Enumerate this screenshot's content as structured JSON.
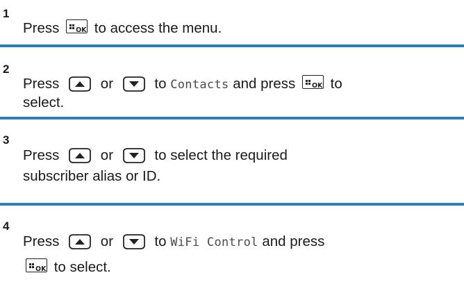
{
  "steps": [
    {
      "number": "1",
      "lines": [
        [
          {
            "t": "text",
            "v": "Press "
          },
          {
            "t": "key",
            "k": "ok"
          },
          {
            "t": "text",
            "v": " to access the menu."
          }
        ]
      ]
    },
    {
      "number": "2",
      "lines": [
        [
          {
            "t": "text",
            "v": "Press "
          },
          {
            "t": "key",
            "k": "up"
          },
          {
            "t": "text",
            "v": " or "
          },
          {
            "t": "key",
            "k": "down"
          },
          {
            "t": "text",
            "v": " to "
          },
          {
            "t": "mono",
            "v": "Contacts"
          },
          {
            "t": "text",
            "v": " and press "
          },
          {
            "t": "key",
            "k": "ok"
          },
          {
            "t": "text",
            "v": " to"
          }
        ],
        [
          {
            "t": "text",
            "v": "select."
          }
        ]
      ]
    },
    {
      "number": "3",
      "lines": [
        [
          {
            "t": "text",
            "v": "Press "
          },
          {
            "t": "key",
            "k": "up"
          },
          {
            "t": "text",
            "v": " or "
          },
          {
            "t": "key",
            "k": "down"
          },
          {
            "t": "text",
            "v": " to select the required"
          }
        ],
        [
          {
            "t": "text",
            "v": "subscriber alias or ID."
          }
        ]
      ]
    },
    {
      "number": "4",
      "lines": [
        [
          {
            "t": "text",
            "v": "Press "
          },
          {
            "t": "key",
            "k": "up"
          },
          {
            "t": "text",
            "v": " or "
          },
          {
            "t": "key",
            "k": "down"
          },
          {
            "t": "text",
            "v": " to "
          },
          {
            "t": "mono",
            "v": "WiFi Control"
          },
          {
            "t": "text",
            "v": " and press"
          }
        ],
        [
          {
            "t": "key",
            "k": "ok"
          },
          {
            "t": "text",
            "v": " to select."
          }
        ]
      ]
    }
  ],
  "keys": {
    "ok": {
      "icon": "menu-ok-key-icon",
      "label": "OK"
    },
    "up": {
      "icon": "up-arrow-key-icon"
    },
    "down": {
      "icon": "down-arrow-key-icon"
    }
  },
  "colors": {
    "separator": "#2c7fb8",
    "text": "#1a1a1a",
    "monospace": "#4a4a4a"
  }
}
